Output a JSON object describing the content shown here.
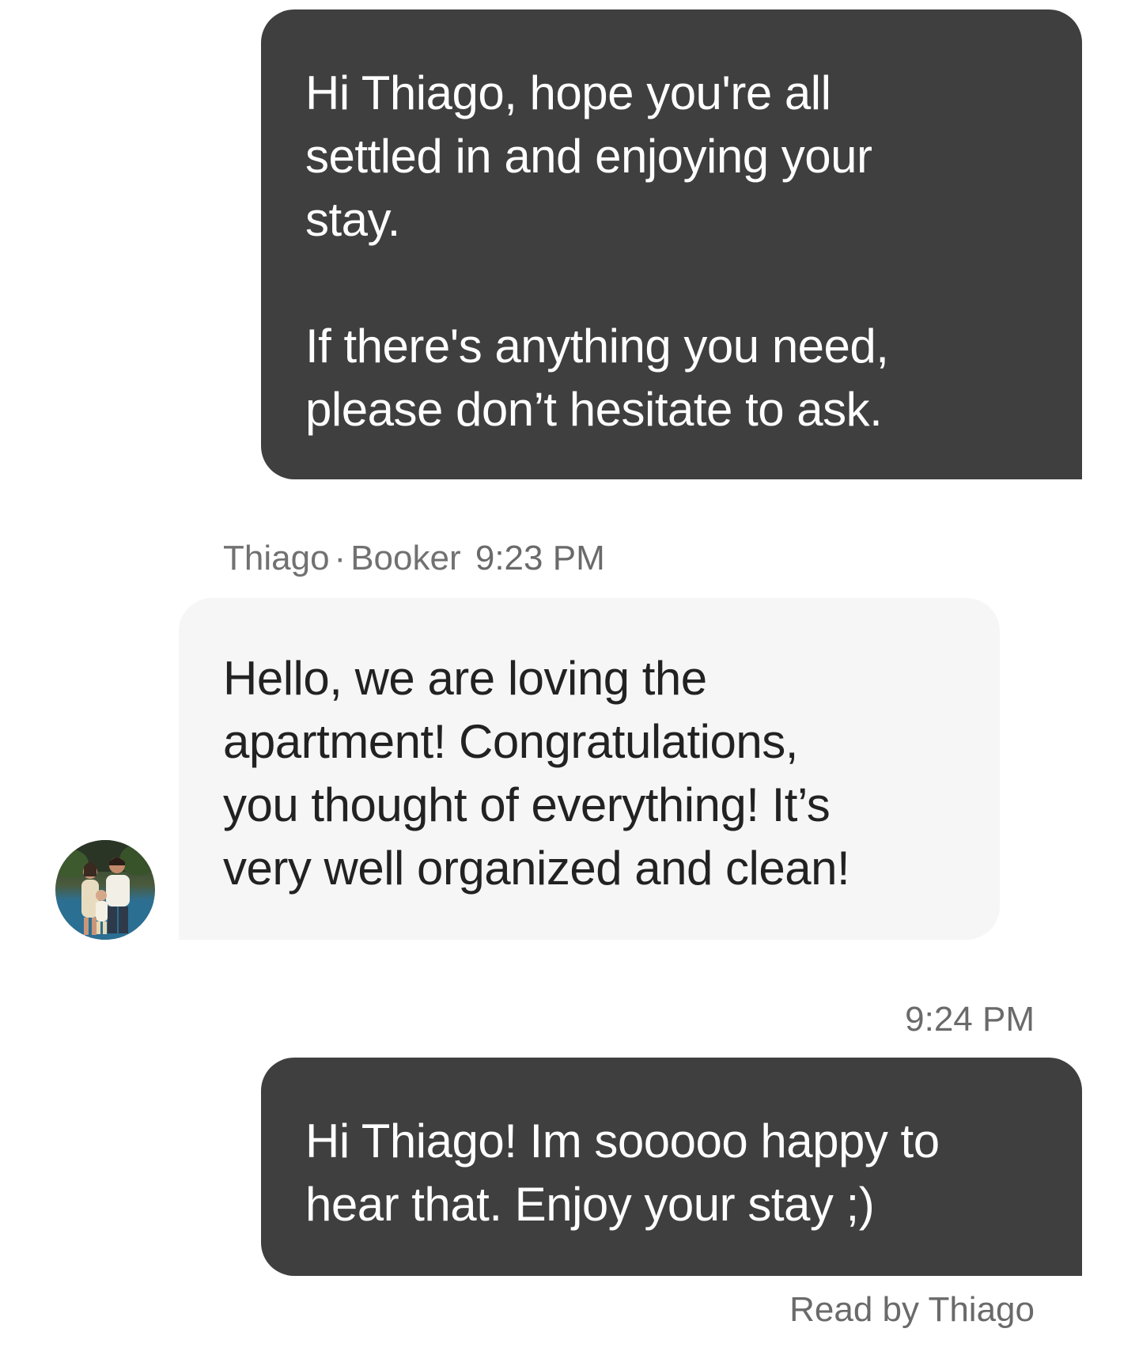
{
  "messages": [
    {
      "paragraphs": [
        "Hi Thiago, hope you're all\nsettled in and enjoying your\nstay.",
        "If there's anything you need,\nplease don’t hesitate to ask."
      ]
    },
    {
      "sender_name": "Thiago",
      "separator": "·",
      "sender_role": "Booker",
      "time": "9:23 PM",
      "text": "Hello, we are loving the\napartment! Congratulations,\nyou thought of everything! It’s\nvery well organized and clean!"
    },
    {
      "time": "9:24 PM",
      "text": "Hi Thiago! Im sooooo happy to\nhear that. Enjoy your stay ;)"
    }
  ],
  "read_receipt": "Read by Thiago",
  "colors": {
    "sent_bubble": "#3f3f3f",
    "received_bubble": "#f6f6f6",
    "meta_text": "#6a6a6a"
  },
  "icons": {
    "avatar": "guest-profile-photo"
  }
}
